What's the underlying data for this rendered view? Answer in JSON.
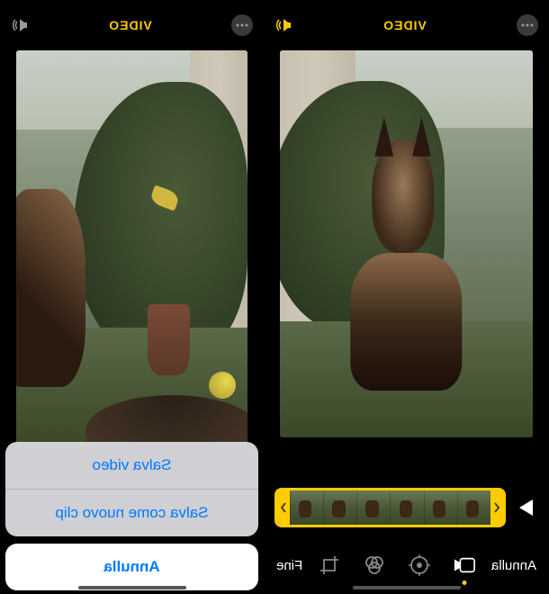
{
  "left_pane": {
    "top_title": "VIDEO",
    "action_sheet": {
      "save_video": "Salva video",
      "save_new_clip": "Salva come nuovo clip",
      "cancel": "Annulla"
    }
  },
  "right_pane": {
    "top_title": "VIDEO",
    "toolbar": {
      "done": "Fine",
      "cancel": "Annulla"
    }
  },
  "icons": {
    "more": "more-options-icon",
    "audio_on": "speaker-on-icon",
    "audio_muted": "speaker-muted-icon",
    "play": "play-icon",
    "video_tool": "video-tool-icon",
    "adjust": "adjust-tool-icon",
    "filters": "filters-tool-icon",
    "crop": "crop-tool-icon"
  },
  "colors": {
    "accent": "#ffcc00",
    "link": "#007aff",
    "background": "#000000"
  }
}
